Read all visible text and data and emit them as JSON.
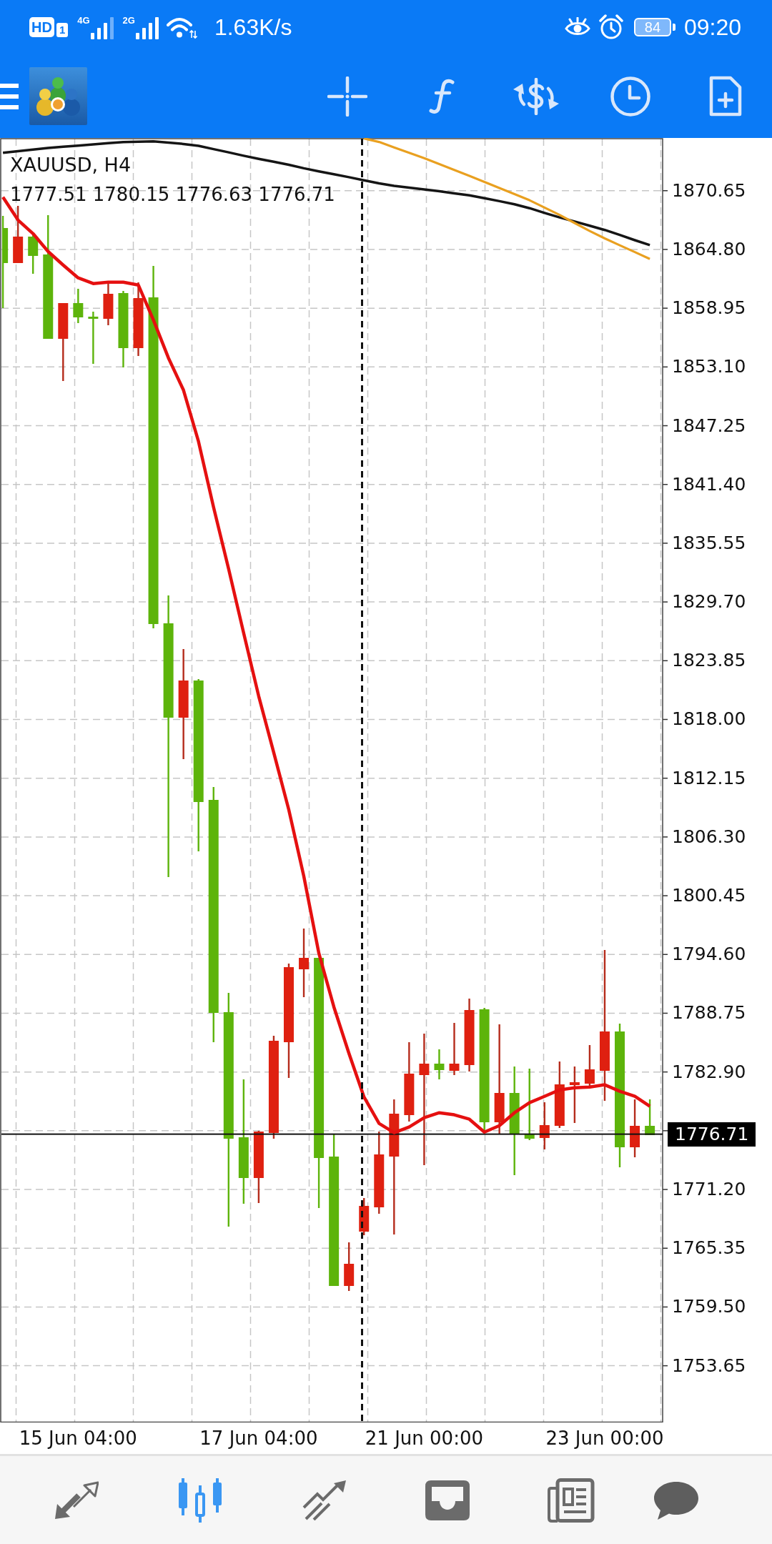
{
  "status_bar": {
    "hd_badge": "HD",
    "sim_badge": "1",
    "networks": [
      "4G",
      "2G"
    ],
    "speed": "1.63K/s",
    "battery": "84",
    "time": "09:20"
  },
  "chart": {
    "title": "XAUUSD, H4",
    "ohlc": "1777.51 1780.15 1776.63 1776.71",
    "current_price": "1776.71",
    "chart_data": {
      "type": "line",
      "categories": [
        null,
        null,
        null,
        null,
        null,
        "15 Jun 04:00",
        null,
        null,
        null,
        null,
        null,
        null,
        null,
        null,
        null,
        null,
        null,
        "17 Jun 04:00",
        null,
        null,
        null,
        null,
        null,
        null,
        null,
        null,
        null,
        null,
        "21 Jun 00:00",
        null,
        null,
        null,
        null,
        null,
        null,
        null,
        null,
        null,
        null,
        null,
        "23 Jun 00:00",
        null,
        null,
        null
      ],
      "series": [
        {
          "color": "#151515",
          "values": [
            1874.42,
            1874.59,
            1874.75,
            1874.91,
            1875.03,
            1875.14,
            1875.25,
            1875.38,
            1875.49,
            1875.53,
            1875.56,
            1875.43,
            1875.3,
            1875.12,
            1874.79,
            1874.47,
            1874.13,
            1873.82,
            1873.53,
            1873.23,
            1872.88,
            1872.57,
            1872.29,
            1871.99,
            1871.68,
            1871.38,
            1871.13,
            1870.96,
            1870.78,
            1870.59,
            1870.39,
            1870.19,
            1869.91,
            1869.61,
            1869.3,
            1868.91,
            1868.44,
            1867.99,
            1867.58,
            1867.17,
            1866.74,
            1866.24,
            1865.72,
            1865.24
          ]
        },
        {
          "color": "#e9a020",
          "values": [
            null,
            null,
            null,
            null,
            null,
            null,
            null,
            null,
            null,
            null,
            null,
            null,
            null,
            null,
            null,
            null,
            null,
            null,
            null,
            null,
            null,
            null,
            null,
            null,
            1875.85,
            1875.5,
            1874.96,
            1874.43,
            1873.89,
            1873.3,
            1872.71,
            1872.13,
            1871.53,
            1870.92,
            1870.31,
            1869.7,
            1868.97,
            1868.24,
            1867.43,
            1866.64,
            1865.9,
            1865.22,
            1864.54,
            1863.86
          ]
        },
        {
          "color": "#e51010",
          "values": [
            1870.01,
            1867.73,
            1866.38,
            1864.6,
            1863.25,
            1861.97,
            1861.4,
            1861.54,
            1861.54,
            1861.26,
            1857.77,
            1854.0,
            1850.79,
            1845.67,
            1839.12,
            1833.0,
            1826.6,
            1820.33,
            1814.71,
            1809.02,
            1802.4,
            1794.71,
            1789.37,
            1784.75,
            1780.41,
            1777.77,
            1776.85,
            1777.42,
            1778.34,
            1778.84,
            1778.63,
            1778.2,
            1776.92,
            1777.56,
            1778.84,
            1779.84,
            1780.48,
            1781.12,
            1781.33,
            1781.4,
            1781.62,
            1780.98,
            1780.48,
            1779.48
          ]
        }
      ],
      "ylim": [
        1748.0,
        1875.9
      ],
      "yticks": [
        {
          "value": 1870.65,
          "label": "1870.65"
        },
        {
          "value": 1864.8,
          "label": "1864.80"
        },
        {
          "value": 1858.95,
          "label": "1858.95"
        },
        {
          "value": 1853.1,
          "label": "1853.10"
        },
        {
          "value": 1847.25,
          "label": "1847.25"
        },
        {
          "value": 1841.4,
          "label": "1841.40"
        },
        {
          "value": 1835.55,
          "label": "1835.55"
        },
        {
          "value": 1829.7,
          "label": "1829.70"
        },
        {
          "value": 1823.85,
          "label": "1823.85"
        },
        {
          "value": 1818.0,
          "label": "1818.00"
        },
        {
          "value": 1812.15,
          "label": "1812.15"
        },
        {
          "value": 1806.3,
          "label": "1806.30"
        },
        {
          "value": 1800.45,
          "label": "1800.45"
        },
        {
          "value": 1794.6,
          "label": "1794.60"
        },
        {
          "value": 1788.75,
          "label": "1788.75"
        },
        {
          "value": 1782.9,
          "label": "1782.90"
        },
        {
          "value": 1771.2,
          "label": "1771.20"
        },
        {
          "value": 1765.35,
          "label": "1765.35"
        },
        {
          "value": 1759.5,
          "label": "1759.50"
        },
        {
          "value": 1753.65,
          "label": "1753.65"
        }
      ],
      "grid": true,
      "ref_lines": [
        {
          "axis": "y",
          "value": 1776.71,
          "color": "#111111"
        }
      ]
    }
  },
  "bottom_nav": [
    {
      "kind": "arrows",
      "selected": false
    },
    {
      "kind": "candles",
      "selected": true
    },
    {
      "kind": "trend",
      "selected": false
    },
    {
      "kind": "tray",
      "selected": false
    },
    {
      "kind": "newspaper",
      "selected": false
    },
    {
      "kind": "bubble",
      "selected": false
    }
  ]
}
